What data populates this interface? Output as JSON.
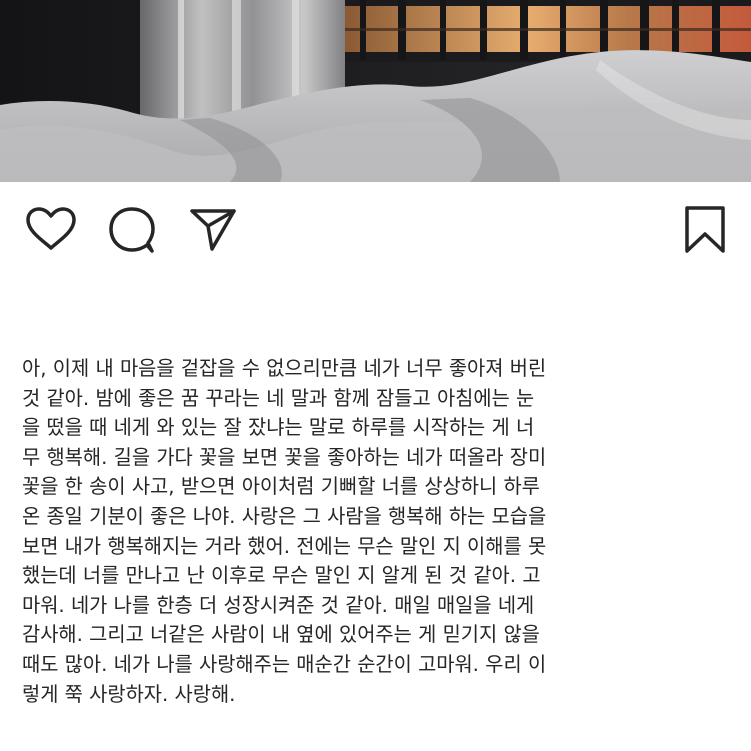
{
  "post": {
    "photo": {
      "subject": "bedroom-window-photo",
      "colors": {
        "sheets": "#d8d8d8",
        "wall": "#1f1f21",
        "window_glow": "#e0a36a",
        "curtain": "#c9c9c9"
      }
    },
    "actions": {
      "like_icon": "heart-icon",
      "comment_icon": "comment-icon",
      "share_icon": "send-icon",
      "save_icon": "bookmark-icon"
    },
    "caption_lines": [
      "아, 이제 내 마음을 겉잡을 수 없으리만큼 네가 너무 좋아져 버린",
      "것 같아. 밤에 좋은 꿈 꾸라는 네 말과 함께 잠들고 아침에는 눈",
      "을 떴을 때 네게 와 있는 잘 잤냐는 말로 하루를 시작하는 게 너",
      "무 행복해. 길을 가다 꽃을 보면 꽃을 좋아하는 네가 떠올라 장미",
      "꽃을 한 송이 사고, 받으면 아이처럼 기뻐할 너를 상상하니 하루",
      "온 종일 기분이 좋은 나야. 사랑은 그 사람을 행복해 하는 모습을",
      "보면 내가 행복해지는 거라 했어. 전에는 무슨 말인 지 이해를 못",
      "했는데 너를 만나고 난 이후로 무슨 말인 지 알게 된 것 같아. 고",
      "마워. 네가 나를 한층 더 성장시켜준 것 같아. 매일 매일을 네게",
      "감사해. 그리고 너같은 사람이 내 옆에 있어주는 게 믿기지 않을",
      "때도 많아. 네가 나를 사랑해주는 매순간 순간이 고마워. 우리 이",
      "렇게 쭉 사랑하자. 사랑해."
    ]
  }
}
